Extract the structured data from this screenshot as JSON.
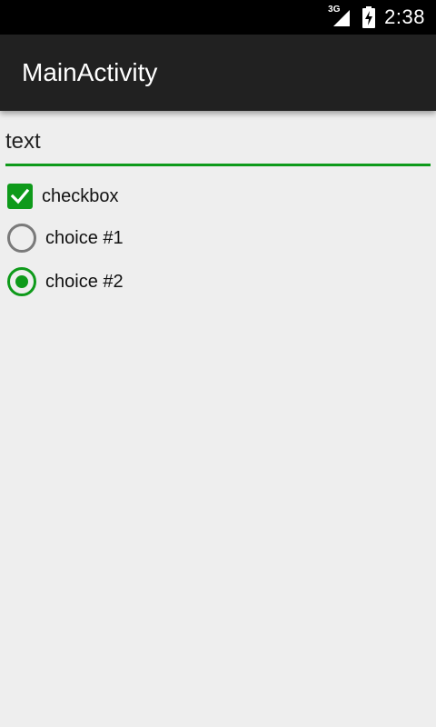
{
  "status_bar": {
    "network_label": "3G",
    "time": "2:38",
    "icons": [
      "signal-icon",
      "battery-icon"
    ]
  },
  "app_bar": {
    "title": "MainActivity"
  },
  "form": {
    "text_field_value": "text",
    "checkbox": {
      "label": "checkbox",
      "checked": true
    },
    "radio_options": [
      {
        "label": "choice #1",
        "checked": false
      },
      {
        "label": "choice #2",
        "checked": true
      }
    ]
  },
  "colors": {
    "accent": "#0e9a1a",
    "app_bar": "#212121",
    "status_bar": "#000000",
    "background": "#eeeeee",
    "radio_unchecked": "#7a7a7a"
  }
}
